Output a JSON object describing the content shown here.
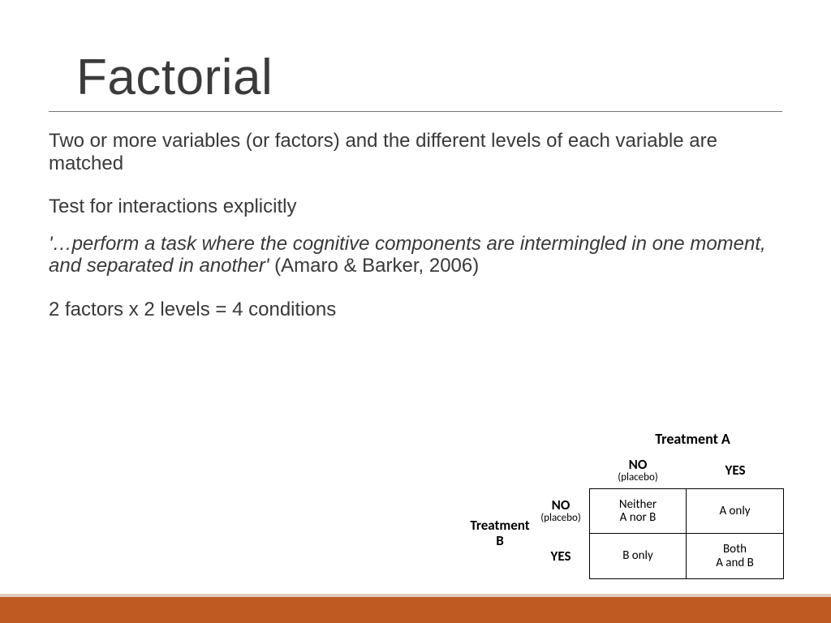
{
  "title": "Factorial",
  "paragraphs": {
    "p1": "Two or more variables (or factors) and the different levels of each variable are matched",
    "p2": "Test for interactions explicitly",
    "quote_italic": "'…perform a task where the cognitive components are intermingled in one moment, and separated in another'",
    "quote_cite": " (Amaro & Barker, 2006)",
    "factors_line": "2 factors x 2 levels = 4 conditions"
  },
  "diagram": {
    "treatment_a": "Treatment A",
    "treatment_b_line1": "Treatment",
    "treatment_b_line2": "B",
    "col_no_big": "NO",
    "col_no_small": "(placebo)",
    "col_yes": "YES",
    "row_no_big": "NO",
    "row_no_small": "(placebo)",
    "row_yes": "YES",
    "cell_tl_line1": "Neither",
    "cell_tl_line2": "A nor  B",
    "cell_tr": "A only",
    "cell_bl": "B only",
    "cell_br_line1": "Both",
    "cell_br_line2": "A and B"
  },
  "chart_data": {
    "type": "table",
    "title": "2×2 factorial design",
    "row_factor": "Treatment B",
    "col_factor": "Treatment A",
    "row_levels": [
      "NO (placebo)",
      "YES"
    ],
    "col_levels": [
      "NO (placebo)",
      "YES"
    ],
    "cells": [
      [
        "Neither A nor B",
        "A only"
      ],
      [
        "B only",
        "Both A and B"
      ]
    ]
  }
}
